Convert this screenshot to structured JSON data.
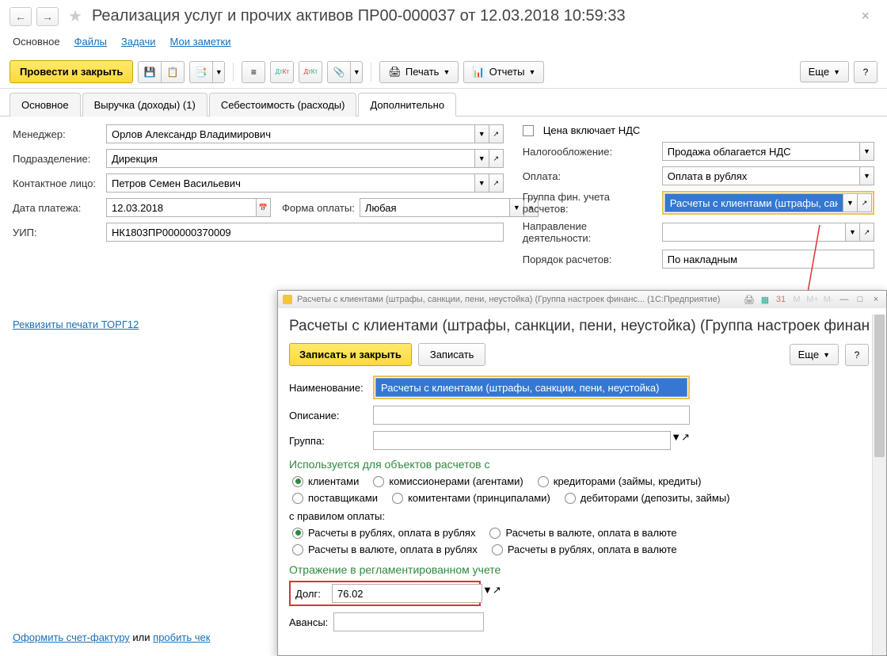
{
  "header": {
    "title": "Реализация услуг и прочих активов ПР00-000037 от 12.03.2018 10:59:33"
  },
  "nav": {
    "main": "Основное",
    "files": "Файлы",
    "tasks": "Задачи",
    "notes": "Мои заметки"
  },
  "toolbar": {
    "post_close": "Провести и закрыть",
    "print": "Печать",
    "reports": "Отчеты",
    "more": "Еще"
  },
  "tabs": {
    "t1": "Основное",
    "t2": "Выручка (доходы) (1)",
    "t3": "Себестоимость (расходы)",
    "t4": "Дополнительно"
  },
  "form": {
    "manager_l": "Менеджер:",
    "manager": "Орлов Александр Владимирович",
    "dept_l": "Подразделение:",
    "dept": "Дирекция",
    "contact_l": "Контактное лицо:",
    "contact": "Петров Семен Васильевич",
    "paydate_l": "Дата платежа:",
    "paydate": "12.03.2018",
    "payform_l": "Форма оплаты:",
    "payform": "Любая",
    "uip_l": "УИП:",
    "uip": "НК1803ПР000000370009",
    "vat_cb": "Цена включает НДС",
    "tax_l": "Налогообложение:",
    "tax": "Продажа облагается НДС",
    "payment_l": "Оплата:",
    "payment": "Оплата в рублях",
    "fingroup_l": "Группа фин. учета расчетов:",
    "fingroup": "Расчеты с клиентами (штрафы, санкции, пени, неусто",
    "activity_l": "Направление деятельности:",
    "activity": "",
    "settle_l": "Порядок расчетов:",
    "settle": "По накладным",
    "req_link": "Реквизиты печати ТОРГ12"
  },
  "footer": {
    "invoice": "Оформить счет-фактуру",
    "or": " или ",
    "check": "пробить чек"
  },
  "modal": {
    "bar": "Расчеты с клиентами (штрафы, санкции, пени, неустойка) (Группа настроек финанс...   (1С:Предприятие)",
    "title": "Расчеты с клиентами (штрафы, санкции, пени, неустойка) (Группа настроек финанс...",
    "save_close": "Записать и закрыть",
    "save": "Записать",
    "more": "Еще",
    "name_l": "Наименование:",
    "name": "Расчеты с клиентами (штрафы, санкции, пени, неустойка)",
    "desc_l": "Описание:",
    "desc": "",
    "group_l": "Группа:",
    "group": "",
    "section1": "Используется для объектов расчетов с",
    "r_clients": "клиентами",
    "r_commiss": "комиссионерами (агентами)",
    "r_cred": "кредиторами (займы, кредиты)",
    "r_suppl": "поставщиками",
    "r_comit": "комитентами (принципалами)",
    "r_debit": "дебиторами (депозиты, займы)",
    "payrule": "с правилом оплаты:",
    "pr1": "Расчеты в рублях, оплата в рублях",
    "pr2": "Расчеты в валюте, оплата в валюте",
    "pr3": "Расчеты в валюте, оплата в рублях",
    "pr4": "Расчеты в рублях, оплата в валюте",
    "section2": "Отражение в регламентированном учете",
    "debt_l": "Долг:",
    "debt": "76.02",
    "advance_l": "Авансы:",
    "advance": ""
  }
}
